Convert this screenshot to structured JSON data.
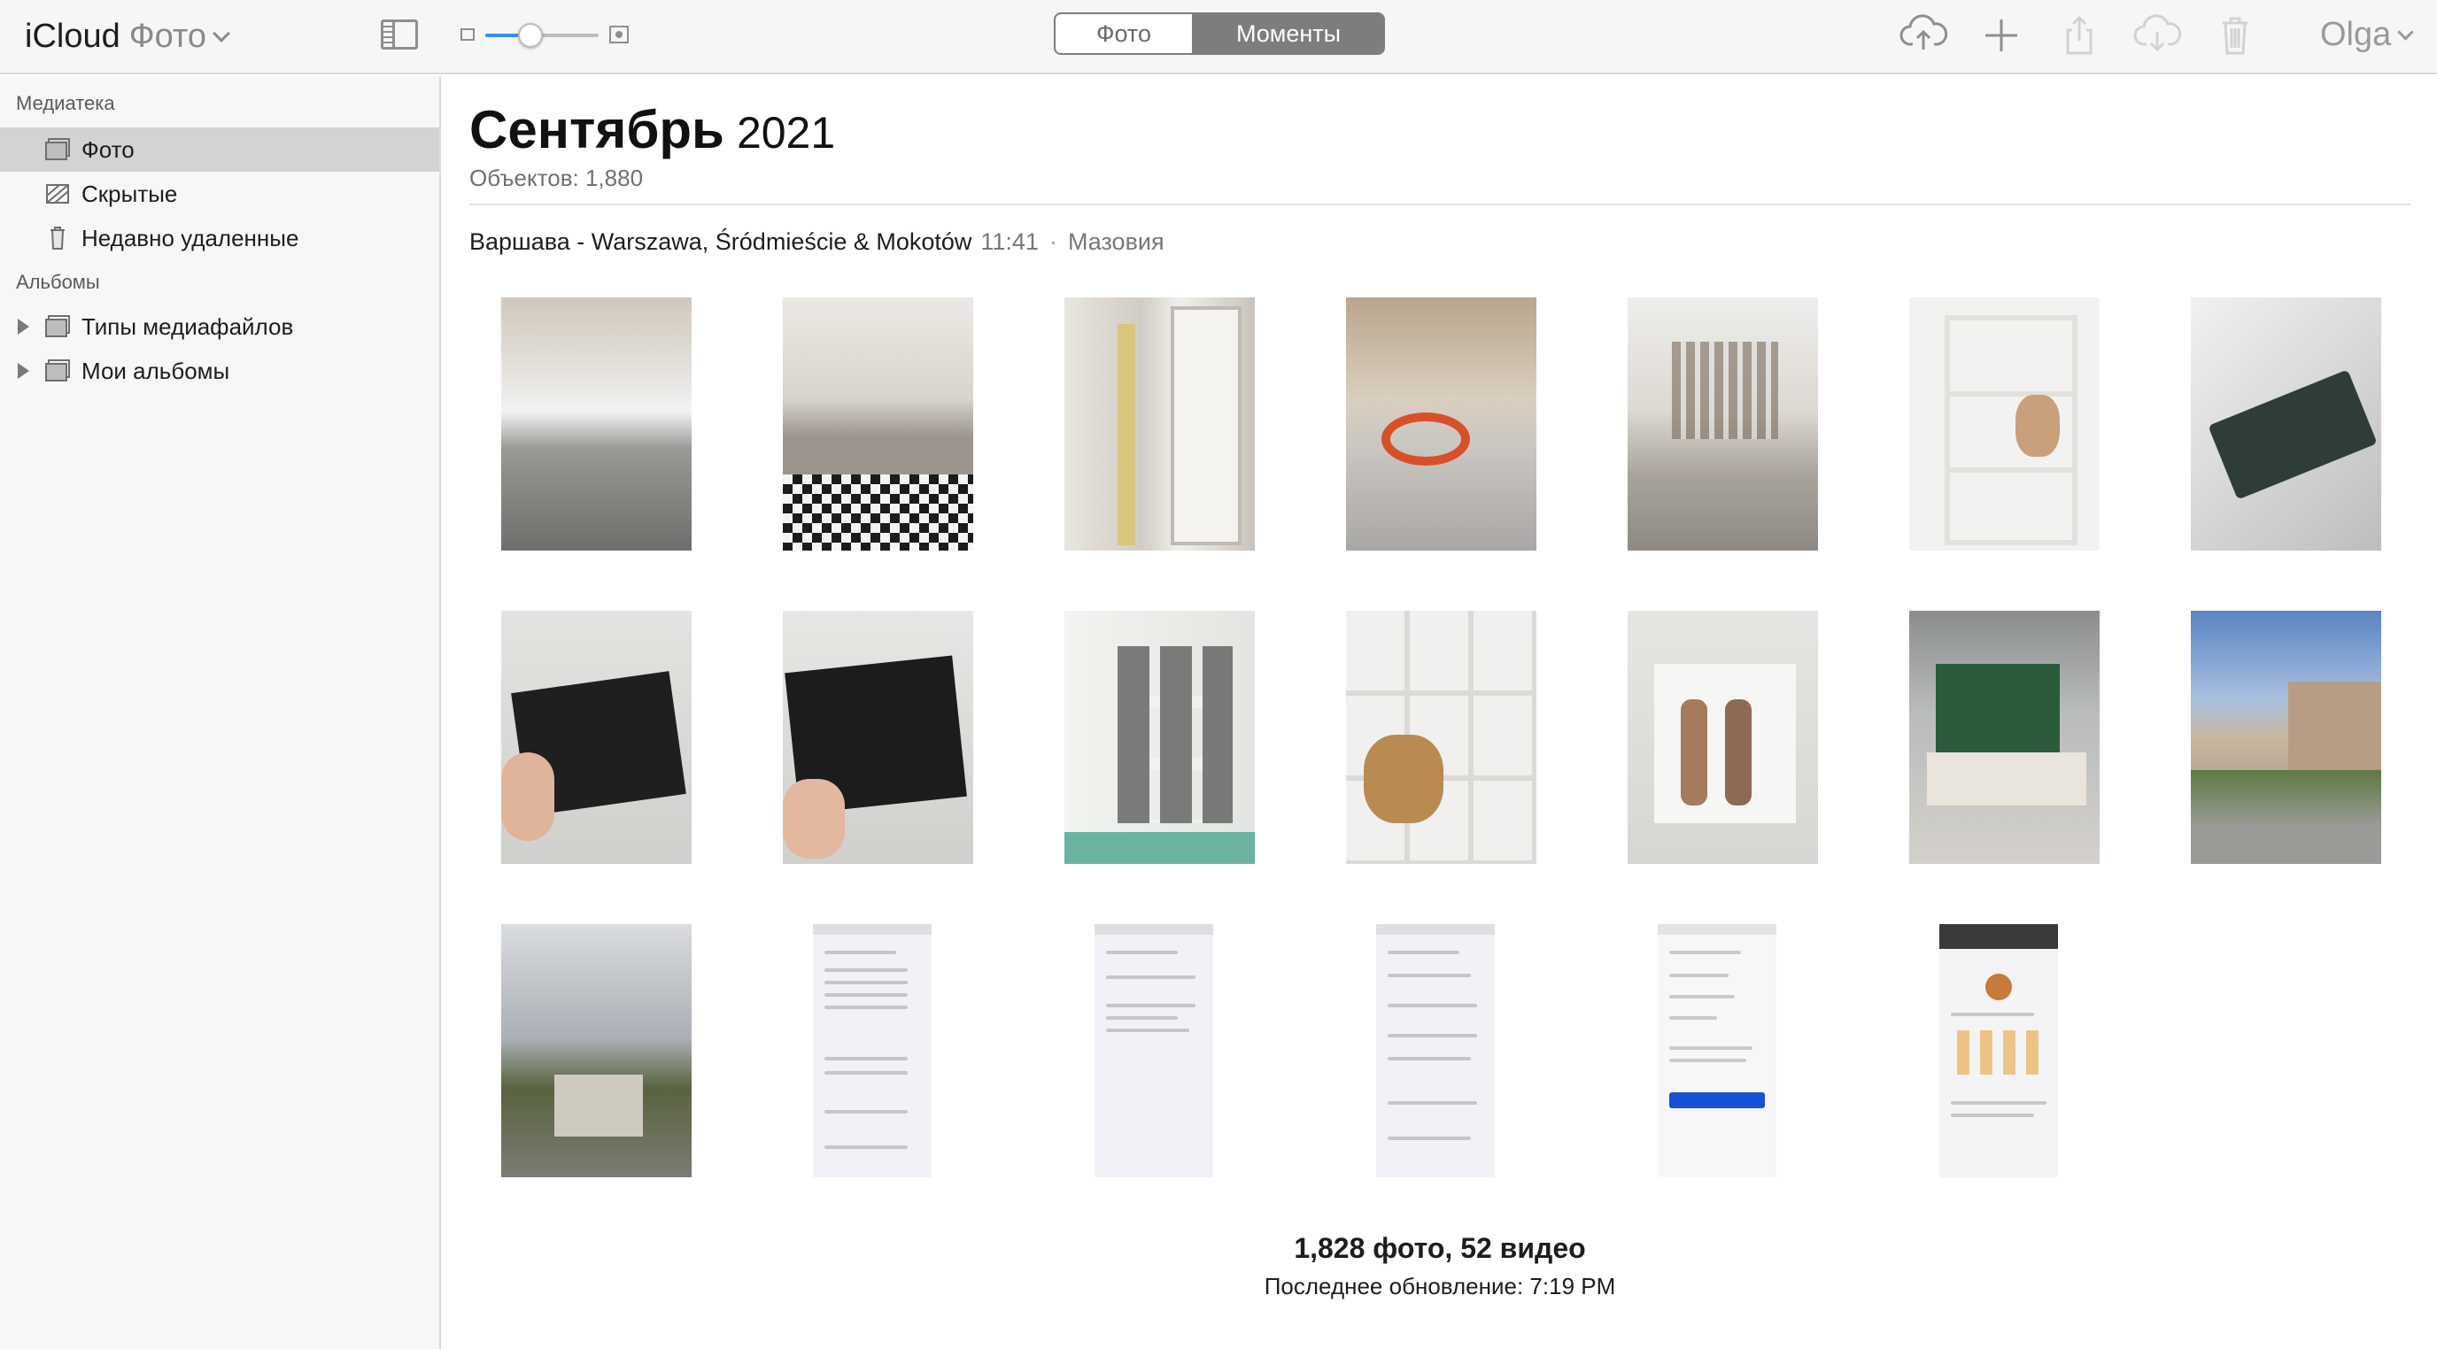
{
  "app": {
    "brand": "iCloud",
    "section": "Фото"
  },
  "toolbar": {
    "segments": [
      "Фото",
      "Моменты"
    ],
    "active_segment": "Моменты",
    "zoom_level": 0.4,
    "icons": [
      "upload-icon",
      "add-icon",
      "share-icon",
      "download-icon",
      "trash-icon"
    ],
    "user": "Olga"
  },
  "sidebar": {
    "library_title": "Медиатека",
    "library_items": [
      {
        "label": "Фото",
        "icon": "photos-icon",
        "selected": true
      },
      {
        "label": "Скрытые",
        "icon": "hidden-icon",
        "selected": false
      },
      {
        "label": "Недавно удаленные",
        "icon": "trash-icon",
        "selected": false
      }
    ],
    "albums_title": "Альбомы",
    "album_items": [
      {
        "label": "Типы медиафайлов",
        "icon": "folder-icon"
      },
      {
        "label": "Мои альбомы",
        "icon": "folder-icon"
      }
    ]
  },
  "main": {
    "month": "Сентябрь",
    "year": "2021",
    "count": "Объектов: 1,880",
    "location": "Варшава - Warszawa, Śródmieście & Mokotów",
    "time": "11:41",
    "separator": "·",
    "region": "Мазовия",
    "footer_counts": "1,828 фото, 52 видео",
    "footer_updated": "Последнее обновление: 7:19 PM"
  },
  "colors": {
    "accent": "#3b8ef5",
    "segment_active": "#7d7d7d",
    "sidebar_selected": "#d3d3d3"
  }
}
